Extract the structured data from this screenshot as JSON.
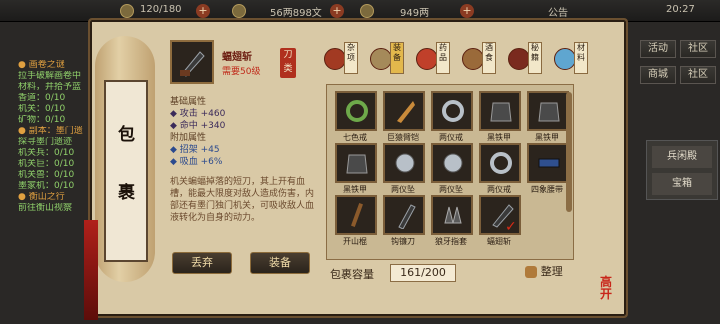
{
  "topbar": {
    "res1": "120/180",
    "res2": "56两898文",
    "res3": "949两",
    "notice": "公告",
    "time": "20:27"
  },
  "quest": {
    "lines": [
      "● 画卷之谜",
      "拉手破解画卷中",
      "材料，并拾予蓝",
      "香道：0/10",
      "机关：0/10",
      "矿物：0/10",
      "● 副本：墨门遗",
      "探寻墨门遗迹",
      "机关兵：0/10",
      "机关巨：0/10",
      "机关兽：0/10",
      "墨家机：0/10",
      "● 衡山之行",
      "前往衡山视察"
    ]
  },
  "right_buttons": [
    "活动",
    "社区",
    "商城",
    "社区"
  ],
  "side_menu": [
    "兵闲殿",
    "宝箱"
  ],
  "scroll_side": [
    "包",
    "裹"
  ],
  "item": {
    "name": "蝠翅斩",
    "requirement": "需要50级",
    "type": "刀类",
    "base_header": "基础属性",
    "base_attrs": [
      "◆ 攻击  +460",
      "◆ 命中  +340"
    ],
    "extra_header": "附加属性",
    "extra_attrs": [
      "◆ 招架  +45",
      "◆ 吸血  +6%"
    ],
    "description": "机关蝙蝠掉落的短刀，其上开有血槽，能最大限度对敌人造成伤害，内部还有墨门独门机关，可吸收敌人血液转化为自身的动力。"
  },
  "buttons": {
    "sell": "丢弃",
    "equip": "装备",
    "sort": "整理"
  },
  "tabs": [
    {
      "label": "杂项",
      "selected": false
    },
    {
      "label": "装备",
      "selected": true
    },
    {
      "label": "药品",
      "selected": false
    },
    {
      "label": "酒食",
      "selected": false
    },
    {
      "label": "秘籍",
      "selected": false
    },
    {
      "label": "材料",
      "selected": false
    }
  ],
  "items": [
    {
      "label": "七色戒"
    },
    {
      "label": "巨猿臂铠"
    },
    {
      "label": "两仪戒"
    },
    {
      "label": "黑铁甲"
    },
    {
      "label": "黑铁甲"
    },
    {
      "label": "黑铁甲"
    },
    {
      "label": "两仪坠"
    },
    {
      "label": "两仪坠"
    },
    {
      "label": "两仪戒"
    },
    {
      "label": "四象腰带"
    },
    {
      "label": "开山棍"
    },
    {
      "label": "钩镰刀"
    },
    {
      "label": "狼牙指套"
    },
    {
      "label": "蝠翅斩"
    }
  ],
  "capacity_label": "包裹容量",
  "capacity_value": "161/200",
  "logo_text": "高开"
}
